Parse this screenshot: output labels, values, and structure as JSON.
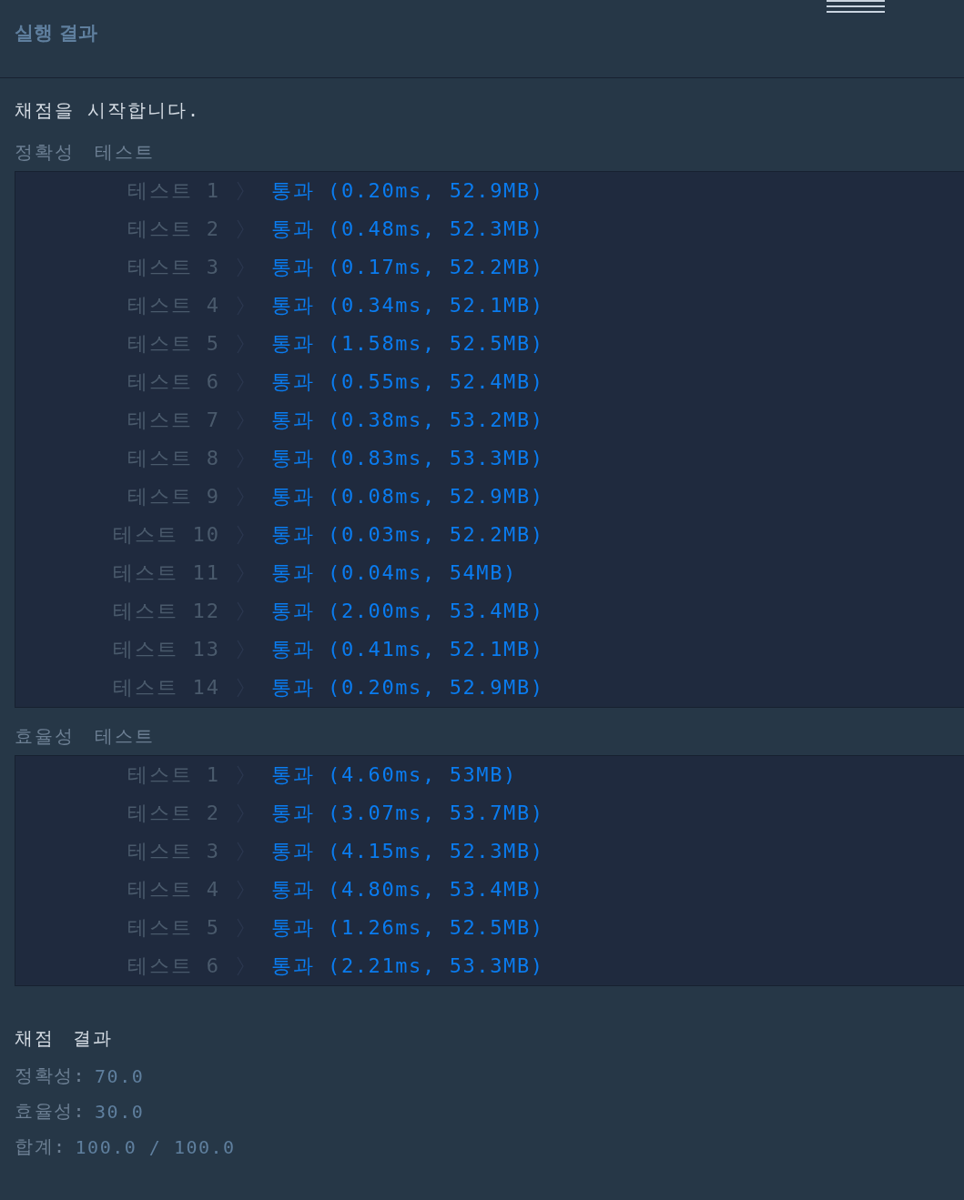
{
  "header": {
    "title": "실행 결과"
  },
  "intro": "채점을 시작합니다.",
  "sections": [
    {
      "title": "정확성  테스트",
      "rows": [
        {
          "label": "테스트 1",
          "result": "통과 (0.20ms, 52.9MB)"
        },
        {
          "label": "테스트 2",
          "result": "통과 (0.48ms, 52.3MB)"
        },
        {
          "label": "테스트 3",
          "result": "통과 (0.17ms, 52.2MB)"
        },
        {
          "label": "테스트 4",
          "result": "통과 (0.34ms, 52.1MB)"
        },
        {
          "label": "테스트 5",
          "result": "통과 (1.58ms, 52.5MB)"
        },
        {
          "label": "테스트 6",
          "result": "통과 (0.55ms, 52.4MB)"
        },
        {
          "label": "테스트 7",
          "result": "통과 (0.38ms, 53.2MB)"
        },
        {
          "label": "테스트 8",
          "result": "통과 (0.83ms, 53.3MB)"
        },
        {
          "label": "테스트 9",
          "result": "통과 (0.08ms, 52.9MB)"
        },
        {
          "label": "테스트 10",
          "result": "통과 (0.03ms, 52.2MB)"
        },
        {
          "label": "테스트 11",
          "result": "통과 (0.04ms, 54MB)"
        },
        {
          "label": "테스트 12",
          "result": "통과 (2.00ms, 53.4MB)"
        },
        {
          "label": "테스트 13",
          "result": "통과 (0.41ms, 52.1MB)"
        },
        {
          "label": "테스트 14",
          "result": "통과 (0.20ms, 52.9MB)"
        }
      ]
    },
    {
      "title": "효율성  테스트",
      "rows": [
        {
          "label": "테스트 1",
          "result": "통과 (4.60ms, 53MB)"
        },
        {
          "label": "테스트 2",
          "result": "통과 (3.07ms, 53.7MB)"
        },
        {
          "label": "테스트 3",
          "result": "통과 (4.15ms, 52.3MB)"
        },
        {
          "label": "테스트 4",
          "result": "통과 (4.80ms, 53.4MB)"
        },
        {
          "label": "테스트 5",
          "result": "통과 (1.26ms, 52.5MB)"
        },
        {
          "label": "테스트 6",
          "result": "통과 (2.21ms, 53.3MB)"
        }
      ]
    }
  ],
  "summary": {
    "title": "채점 결과",
    "lines": [
      {
        "label": "정확성:",
        "value": "70.0"
      },
      {
        "label": "효율성:",
        "value": "30.0"
      },
      {
        "label": "합계:",
        "value": "100.0 / 100.0"
      }
    ]
  }
}
